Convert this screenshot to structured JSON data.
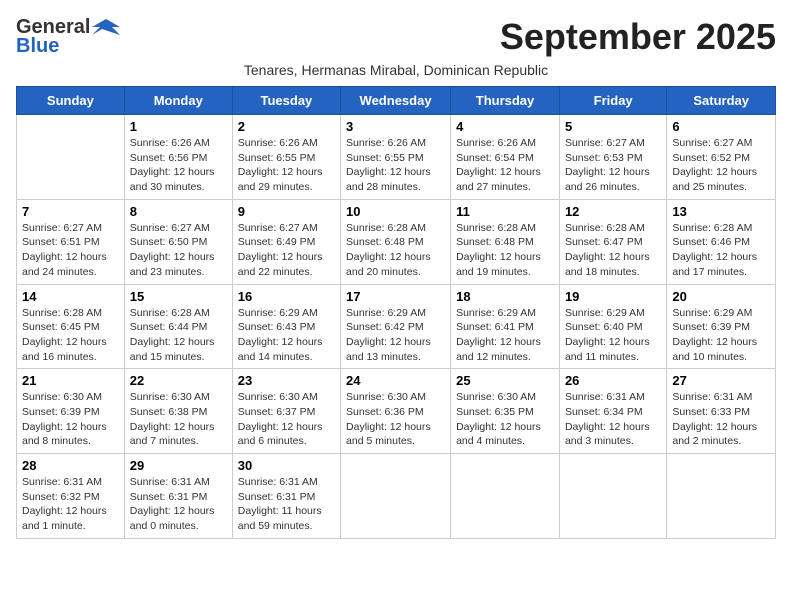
{
  "header": {
    "logo_general": "General",
    "logo_blue": "Blue",
    "month_title": "September 2025",
    "subtitle": "Tenares, Hermanas Mirabal, Dominican Republic"
  },
  "days_of_week": [
    "Sunday",
    "Monday",
    "Tuesday",
    "Wednesday",
    "Thursday",
    "Friday",
    "Saturday"
  ],
  "weeks": [
    [
      {
        "day": "",
        "detail": ""
      },
      {
        "day": "1",
        "detail": "Sunrise: 6:26 AM\nSunset: 6:56 PM\nDaylight: 12 hours\nand 30 minutes."
      },
      {
        "day": "2",
        "detail": "Sunrise: 6:26 AM\nSunset: 6:55 PM\nDaylight: 12 hours\nand 29 minutes."
      },
      {
        "day": "3",
        "detail": "Sunrise: 6:26 AM\nSunset: 6:55 PM\nDaylight: 12 hours\nand 28 minutes."
      },
      {
        "day": "4",
        "detail": "Sunrise: 6:26 AM\nSunset: 6:54 PM\nDaylight: 12 hours\nand 27 minutes."
      },
      {
        "day": "5",
        "detail": "Sunrise: 6:27 AM\nSunset: 6:53 PM\nDaylight: 12 hours\nand 26 minutes."
      },
      {
        "day": "6",
        "detail": "Sunrise: 6:27 AM\nSunset: 6:52 PM\nDaylight: 12 hours\nand 25 minutes."
      }
    ],
    [
      {
        "day": "7",
        "detail": "Sunrise: 6:27 AM\nSunset: 6:51 PM\nDaylight: 12 hours\nand 24 minutes."
      },
      {
        "day": "8",
        "detail": "Sunrise: 6:27 AM\nSunset: 6:50 PM\nDaylight: 12 hours\nand 23 minutes."
      },
      {
        "day": "9",
        "detail": "Sunrise: 6:27 AM\nSunset: 6:49 PM\nDaylight: 12 hours\nand 22 minutes."
      },
      {
        "day": "10",
        "detail": "Sunrise: 6:28 AM\nSunset: 6:48 PM\nDaylight: 12 hours\nand 20 minutes."
      },
      {
        "day": "11",
        "detail": "Sunrise: 6:28 AM\nSunset: 6:48 PM\nDaylight: 12 hours\nand 19 minutes."
      },
      {
        "day": "12",
        "detail": "Sunrise: 6:28 AM\nSunset: 6:47 PM\nDaylight: 12 hours\nand 18 minutes."
      },
      {
        "day": "13",
        "detail": "Sunrise: 6:28 AM\nSunset: 6:46 PM\nDaylight: 12 hours\nand 17 minutes."
      }
    ],
    [
      {
        "day": "14",
        "detail": "Sunrise: 6:28 AM\nSunset: 6:45 PM\nDaylight: 12 hours\nand 16 minutes."
      },
      {
        "day": "15",
        "detail": "Sunrise: 6:28 AM\nSunset: 6:44 PM\nDaylight: 12 hours\nand 15 minutes."
      },
      {
        "day": "16",
        "detail": "Sunrise: 6:29 AM\nSunset: 6:43 PM\nDaylight: 12 hours\nand 14 minutes."
      },
      {
        "day": "17",
        "detail": "Sunrise: 6:29 AM\nSunset: 6:42 PM\nDaylight: 12 hours\nand 13 minutes."
      },
      {
        "day": "18",
        "detail": "Sunrise: 6:29 AM\nSunset: 6:41 PM\nDaylight: 12 hours\nand 12 minutes."
      },
      {
        "day": "19",
        "detail": "Sunrise: 6:29 AM\nSunset: 6:40 PM\nDaylight: 12 hours\nand 11 minutes."
      },
      {
        "day": "20",
        "detail": "Sunrise: 6:29 AM\nSunset: 6:39 PM\nDaylight: 12 hours\nand 10 minutes."
      }
    ],
    [
      {
        "day": "21",
        "detail": "Sunrise: 6:30 AM\nSunset: 6:39 PM\nDaylight: 12 hours\nand 8 minutes."
      },
      {
        "day": "22",
        "detail": "Sunrise: 6:30 AM\nSunset: 6:38 PM\nDaylight: 12 hours\nand 7 minutes."
      },
      {
        "day": "23",
        "detail": "Sunrise: 6:30 AM\nSunset: 6:37 PM\nDaylight: 12 hours\nand 6 minutes."
      },
      {
        "day": "24",
        "detail": "Sunrise: 6:30 AM\nSunset: 6:36 PM\nDaylight: 12 hours\nand 5 minutes."
      },
      {
        "day": "25",
        "detail": "Sunrise: 6:30 AM\nSunset: 6:35 PM\nDaylight: 12 hours\nand 4 minutes."
      },
      {
        "day": "26",
        "detail": "Sunrise: 6:31 AM\nSunset: 6:34 PM\nDaylight: 12 hours\nand 3 minutes."
      },
      {
        "day": "27",
        "detail": "Sunrise: 6:31 AM\nSunset: 6:33 PM\nDaylight: 12 hours\nand 2 minutes."
      }
    ],
    [
      {
        "day": "28",
        "detail": "Sunrise: 6:31 AM\nSunset: 6:32 PM\nDaylight: 12 hours\nand 1 minute."
      },
      {
        "day": "29",
        "detail": "Sunrise: 6:31 AM\nSunset: 6:31 PM\nDaylight: 12 hours\nand 0 minutes."
      },
      {
        "day": "30",
        "detail": "Sunrise: 6:31 AM\nSunset: 6:31 PM\nDaylight: 11 hours\nand 59 minutes."
      },
      {
        "day": "",
        "detail": ""
      },
      {
        "day": "",
        "detail": ""
      },
      {
        "day": "",
        "detail": ""
      },
      {
        "day": "",
        "detail": ""
      }
    ]
  ]
}
